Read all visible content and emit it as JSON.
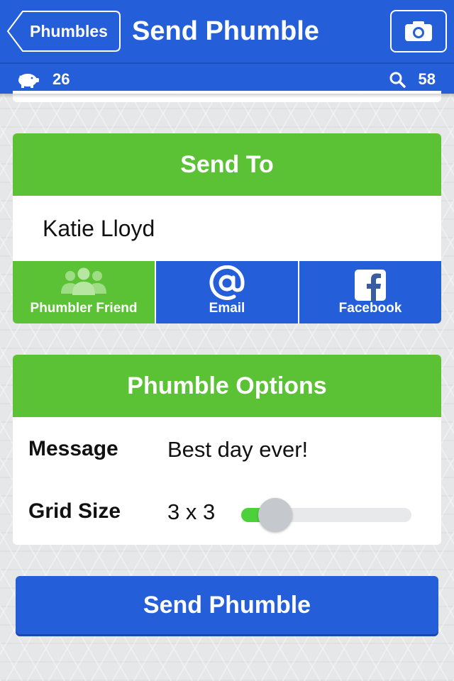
{
  "nav": {
    "back_label": "Phumbles",
    "title": "Send Phumble",
    "camera_icon": "camera-icon"
  },
  "status": {
    "coins_icon": "piggy-bank-icon",
    "coins": "26",
    "search_icon": "search-icon",
    "search_count": "58"
  },
  "send_to": {
    "header": "Send To",
    "recipient": "Katie Lloyd",
    "methods": [
      {
        "label": "Phumbler Friend",
        "icon": "friends-icon",
        "active": true
      },
      {
        "label": "Email",
        "icon": "at-sign-icon",
        "active": false
      },
      {
        "label": "Facebook",
        "icon": "facebook-icon",
        "active": false
      }
    ]
  },
  "options": {
    "header": "Phumble Options",
    "message_label": "Message",
    "message_value": "Best day ever!",
    "grid_label": "Grid Size",
    "grid_value": "3 x 3",
    "grid_slider_fraction": 0.2
  },
  "primary_button": "Send Phumble",
  "colors": {
    "blue": "#245fd9",
    "green": "#5bc236",
    "slider_fill": "#4cd13a"
  }
}
